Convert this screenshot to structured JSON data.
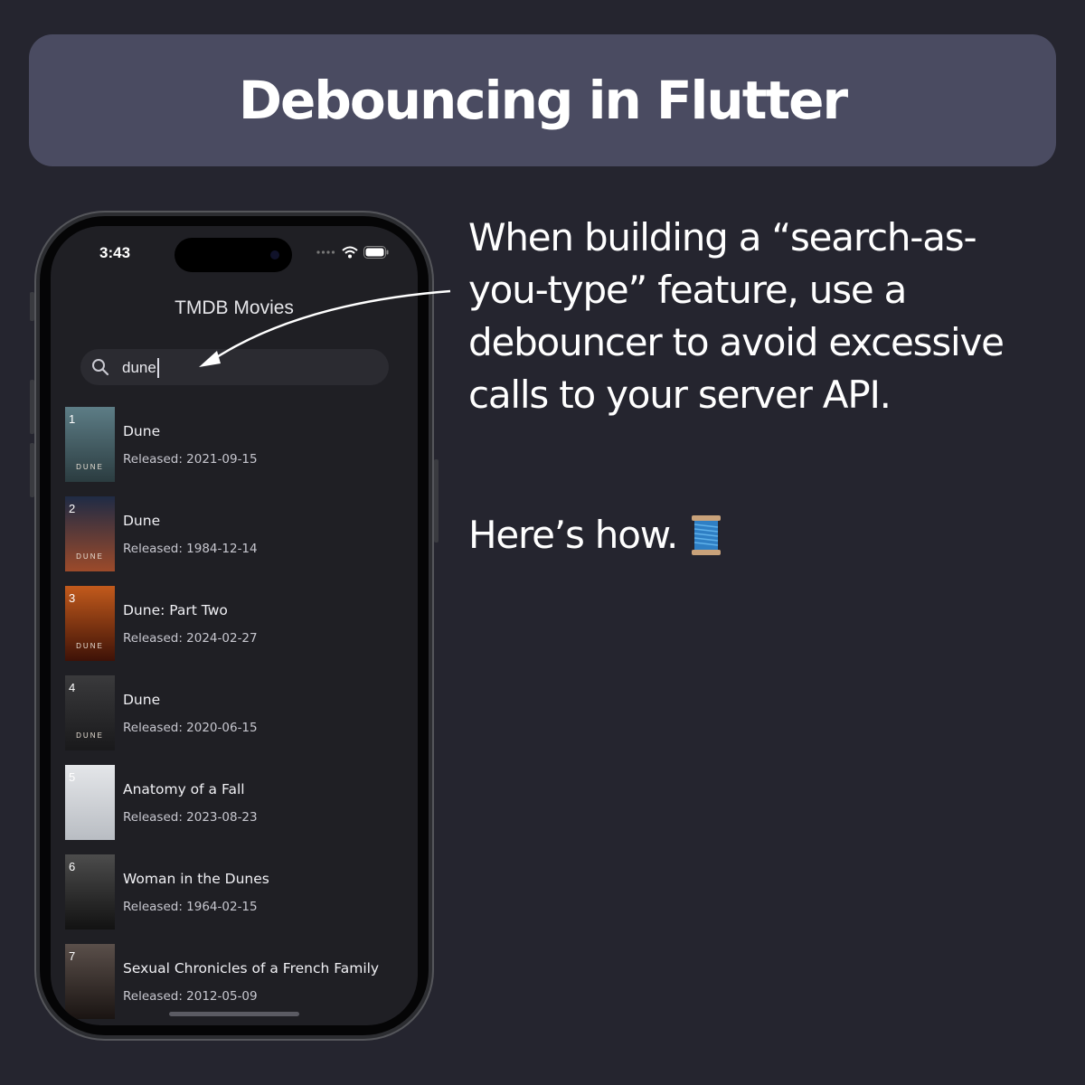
{
  "banner": {
    "title": "Debouncing in Flutter"
  },
  "description": {
    "text": "When building a “search-as-you-type” feature, use a debouncer to avoid excessive calls to your server API.",
    "howto": "Here’s how.",
    "howto_icon": "spool-of-thread-icon"
  },
  "phone": {
    "status": {
      "time": "3:43",
      "icons": [
        "signal-dots-icon",
        "wifi-icon",
        "battery-icon"
      ]
    },
    "app_title": "TMDB Movies",
    "search": {
      "value": "dune",
      "icon": "search-icon"
    },
    "results": [
      {
        "index": "1",
        "title": "Dune",
        "subtitle": "Released: 2021-09-15",
        "poster_word": "DUNE",
        "poster_colors": [
          "#5d7d86",
          "#2b3c40"
        ]
      },
      {
        "index": "2",
        "title": "Dune",
        "subtitle": "Released: 1984-12-14",
        "poster_word": "DUNE",
        "poster_colors": [
          "#1f2b45",
          "#9c4a2a"
        ]
      },
      {
        "index": "3",
        "title": "Dune: Part Two",
        "subtitle": "Released: 2024-02-27",
        "poster_word": "DUNE",
        "poster_colors": [
          "#c25a1c",
          "#3e1207"
        ]
      },
      {
        "index": "4",
        "title": "Dune",
        "subtitle": "Released: 2020-06-15",
        "poster_word": "DUNE",
        "poster_colors": [
          "#3a3a3c",
          "#19191b"
        ]
      },
      {
        "index": "5",
        "title": "Anatomy of a Fall",
        "subtitle": "Released: 2023-08-23",
        "poster_word": "",
        "poster_colors": [
          "#e4e6e9",
          "#b9bdc3"
        ]
      },
      {
        "index": "6",
        "title": "Woman in the Dunes",
        "subtitle": "Released: 1964-02-15",
        "poster_word": "",
        "poster_colors": [
          "#4c4c4c",
          "#121212"
        ]
      },
      {
        "index": "7",
        "title": "Sexual Chronicles of a French Family",
        "subtitle": "Released: 2012-05-09",
        "poster_word": "",
        "poster_colors": [
          "#5a4f4a",
          "#1a1412"
        ]
      }
    ]
  },
  "colors": {
    "background": "#25252f",
    "banner": "#4a4b61",
    "screen": "#1f1f24"
  }
}
